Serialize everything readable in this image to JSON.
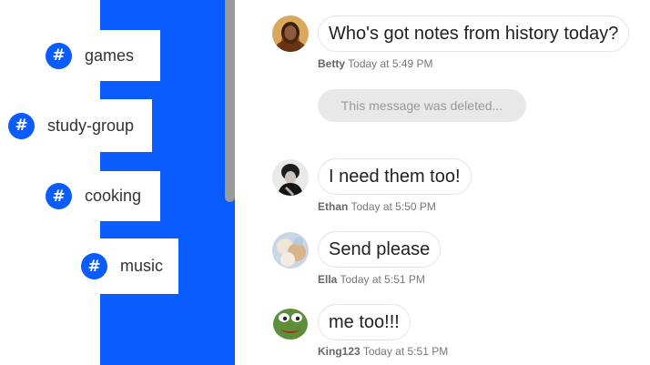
{
  "channels": [
    {
      "name": "games"
    },
    {
      "name": "study-group"
    },
    {
      "name": "cooking"
    },
    {
      "name": "music"
    }
  ],
  "messages": [
    {
      "text": "Who's got notes from history today?",
      "user": "Betty",
      "time": "Today at 5:49 PM"
    },
    {
      "deleted_text": "This message was deleted..."
    },
    {
      "text": "I need them too!",
      "user": "Ethan",
      "time": "Today at 5:50 PM"
    },
    {
      "text": "Send please",
      "user": "Ella",
      "time": "Today at 5:51 PM"
    },
    {
      "text": "me too!!!",
      "user": "King123",
      "time": "Today at 5:51 PM"
    }
  ],
  "colors": {
    "accent": "#0a5cff",
    "scroll_thumb": "#9a9a9a",
    "deleted_bg": "#e8e8e8"
  },
  "icons": {
    "channel_icon": "hash-icon"
  }
}
